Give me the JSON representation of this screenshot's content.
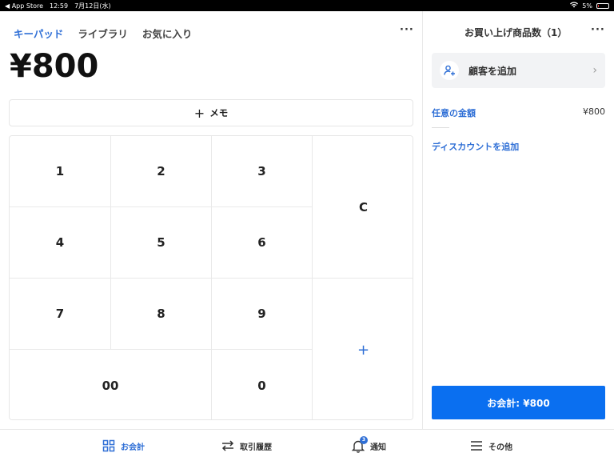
{
  "status_bar": {
    "back_app": "◀ App Store",
    "time": "12:59",
    "date": "7月12日(水)",
    "battery": "5%"
  },
  "tabs": [
    {
      "label": "キーパッド",
      "active": true
    },
    {
      "label": "ライブラリ",
      "active": false
    },
    {
      "label": "お気に入り",
      "active": false
    }
  ],
  "more_label": "···",
  "amount": "¥800",
  "memo": {
    "plus": "+",
    "label": "メモ"
  },
  "keypad": {
    "k1": "1",
    "k2": "2",
    "k3": "3",
    "k4": "4",
    "k5": "5",
    "k6": "6",
    "k7": "7",
    "k8": "8",
    "k9": "9",
    "k00": "00",
    "k0": "0",
    "clear": "C",
    "add": "+"
  },
  "cart": {
    "title": "お買い上げ商品数（1）",
    "add_customer": "顧客を追加",
    "chevron": "›",
    "item_name": "任意の金額",
    "item_price": "¥800",
    "add_discount": "ディスカウントを追加",
    "checkout": "お会計: ¥800"
  },
  "bottom_nav": [
    {
      "label": "お会計",
      "icon": "grid-icon",
      "active": true
    },
    {
      "label": "取引履歴",
      "icon": "transfer-arrows-icon",
      "active": false
    },
    {
      "label": "通知",
      "icon": "bell-icon",
      "active": false,
      "badge": "3"
    },
    {
      "label": "その他",
      "icon": "menu-icon",
      "active": false
    }
  ],
  "colors": {
    "accent": "#2f6fd6",
    "checkout_bg": "#0a6ff0"
  }
}
